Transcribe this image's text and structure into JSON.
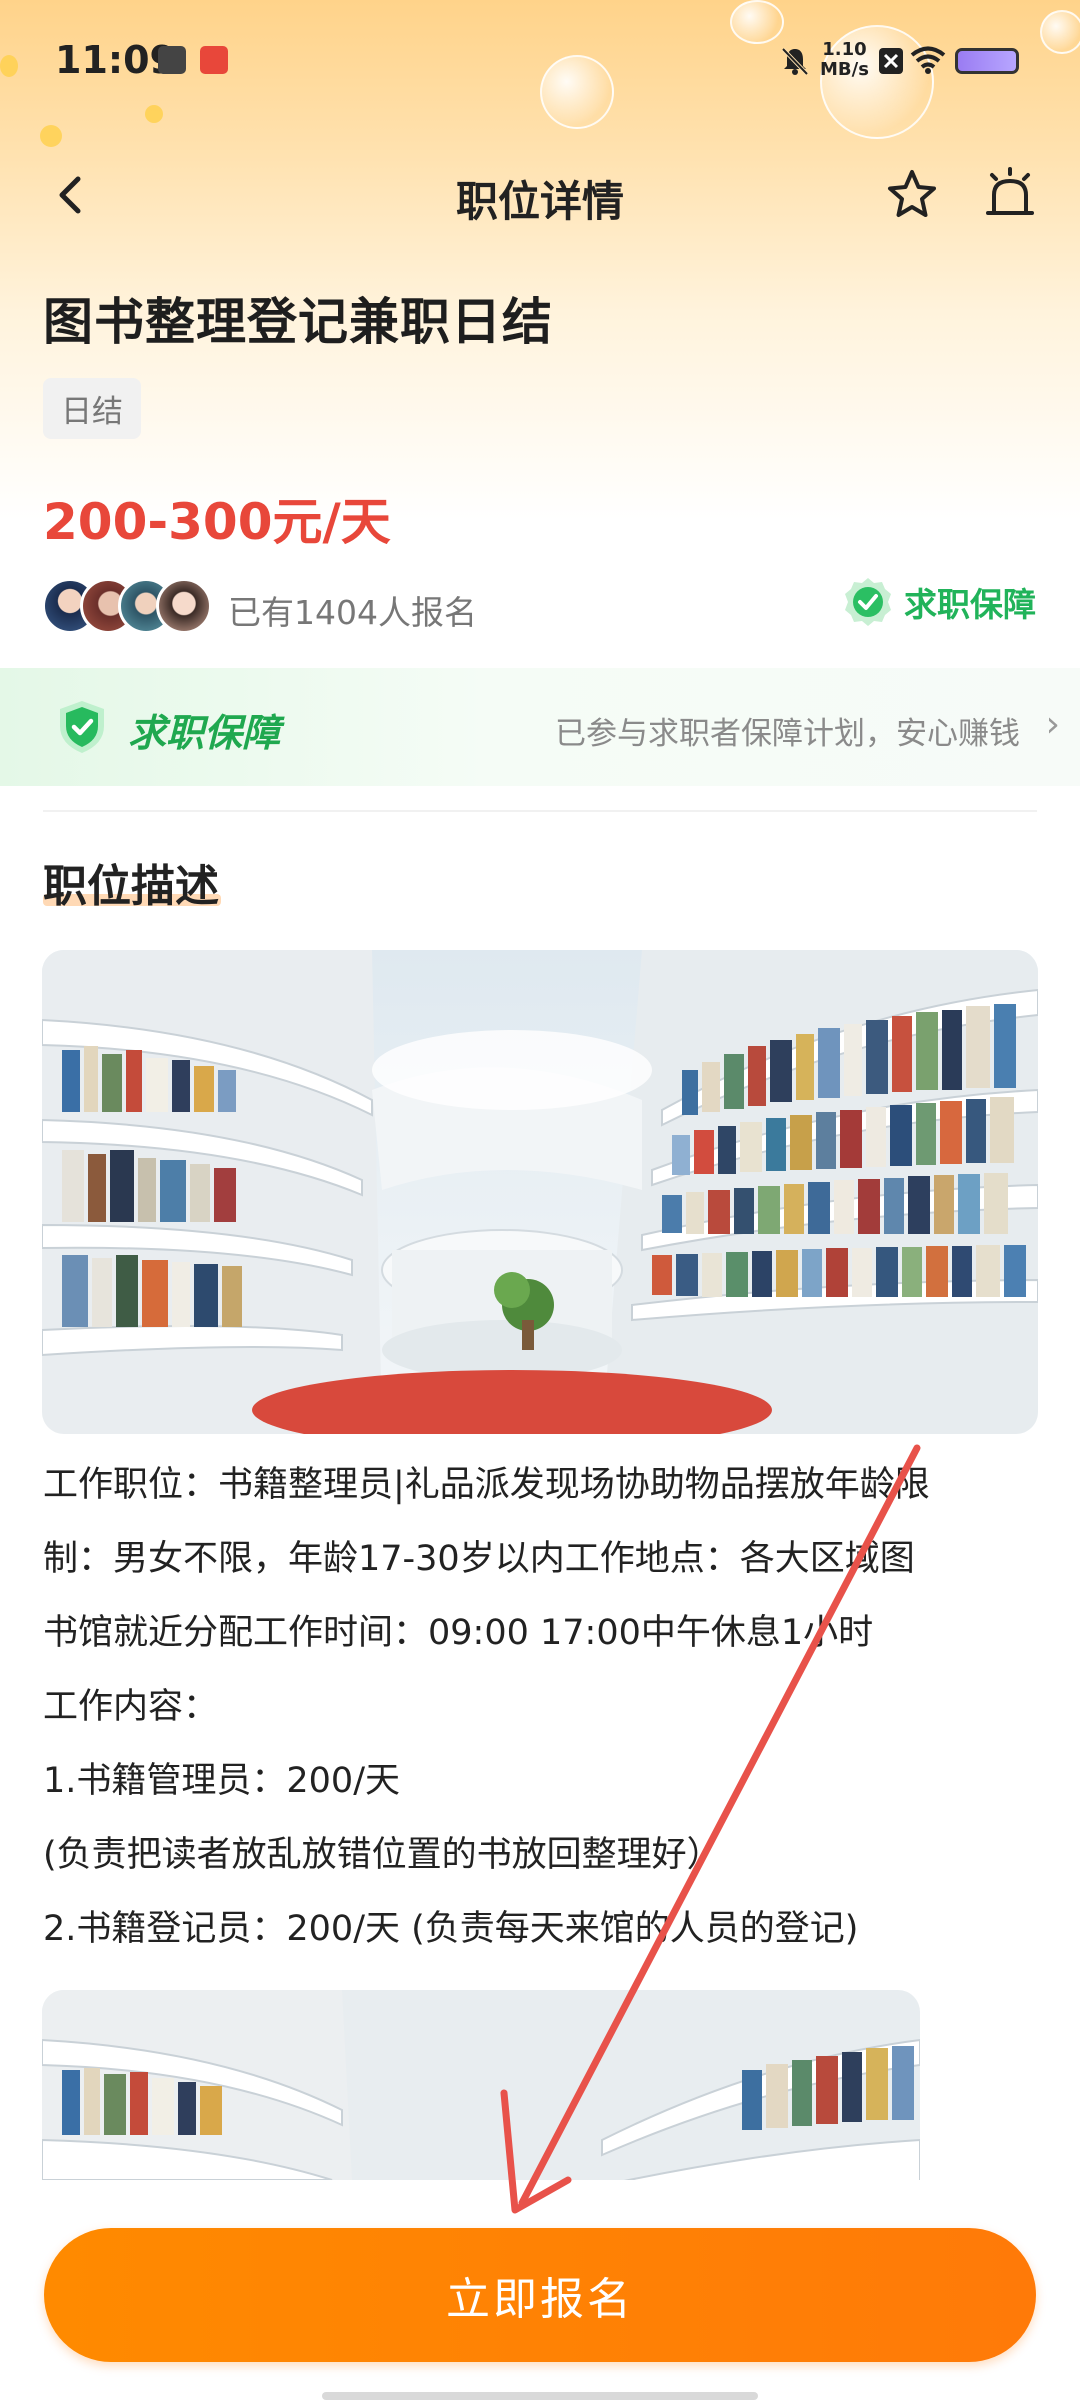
{
  "status_bar": {
    "time": "11:09",
    "network_speed_value": "1.10",
    "network_speed_unit": "MB/s"
  },
  "header": {
    "title": "职位详情"
  },
  "job": {
    "title": "图书整理登记兼职日结",
    "tag": "日结",
    "salary": "200-300元/天",
    "apply_count": "已有1404人报名",
    "guarantee_badge": "求职保障"
  },
  "guarantee_banner": {
    "title": "求职保障",
    "description": "已参与求职者保障计划，安心赚钱",
    "chevron": "›"
  },
  "description": {
    "section_title": "职位描述",
    "lines": [
      "工作职位：书籍整理员|礼品派发现场协助物品摆放年龄限",
      "制：男女不限，年龄17-30岁以内工作地点：各大区域图",
      "书馆就近分配工作时间：09:00 17:00中午休息1小时",
      "工作内容：",
      "1.书籍管理员：200/天",
      "(负责把读者放乱放错位置的书放回整理好）",
      "2.书籍登记员：200/天 (负责每天来馆的人员的登记)"
    ]
  },
  "cta": {
    "label": "立即报名"
  },
  "colors": {
    "accent_orange": "#ff8000",
    "salary_red": "#e8473a",
    "guarantee_green": "#21b35a",
    "annotation_arrow": "#e8524a"
  }
}
